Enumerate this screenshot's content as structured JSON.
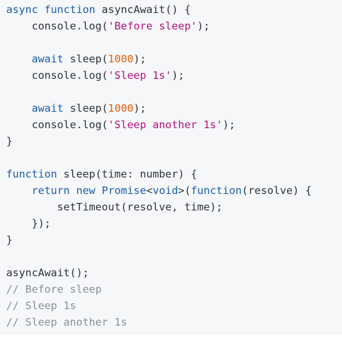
{
  "colors": {
    "background": "#f6f7f9",
    "plain": "#2f3337",
    "keyword": "#1b5ea8",
    "string": "#b3127d",
    "number": "#ea5d0b",
    "comment": "#8b9096"
  },
  "code": {
    "lines": [
      [
        {
          "type": "keyword",
          "text": "async"
        },
        {
          "type": "plain",
          "text": " "
        },
        {
          "type": "keyword",
          "text": "function"
        },
        {
          "type": "plain",
          "text": " asyncAwait() {"
        }
      ],
      [
        {
          "type": "plain",
          "text": "    console.log("
        },
        {
          "type": "string",
          "text": "'Before sleep'"
        },
        {
          "type": "plain",
          "text": ");"
        }
      ],
      [],
      [
        {
          "type": "plain",
          "text": "    "
        },
        {
          "type": "keyword",
          "text": "await"
        },
        {
          "type": "plain",
          "text": " sleep("
        },
        {
          "type": "number",
          "text": "1000"
        },
        {
          "type": "plain",
          "text": ");"
        }
      ],
      [
        {
          "type": "plain",
          "text": "    console.log("
        },
        {
          "type": "string",
          "text": "'Sleep 1s'"
        },
        {
          "type": "plain",
          "text": ");"
        }
      ],
      [],
      [
        {
          "type": "plain",
          "text": "    "
        },
        {
          "type": "keyword",
          "text": "await"
        },
        {
          "type": "plain",
          "text": " sleep("
        },
        {
          "type": "number",
          "text": "1000"
        },
        {
          "type": "plain",
          "text": ");"
        }
      ],
      [
        {
          "type": "plain",
          "text": "    console.log("
        },
        {
          "type": "string",
          "text": "'Sleep another 1s'"
        },
        {
          "type": "plain",
          "text": ");"
        }
      ],
      [
        {
          "type": "plain",
          "text": "}"
        }
      ],
      [],
      [
        {
          "type": "keyword",
          "text": "function"
        },
        {
          "type": "plain",
          "text": " sleep(time: number) {"
        }
      ],
      [
        {
          "type": "plain",
          "text": "    "
        },
        {
          "type": "keyword",
          "text": "return"
        },
        {
          "type": "plain",
          "text": " "
        },
        {
          "type": "keyword",
          "text": "new"
        },
        {
          "type": "plain",
          "text": " "
        },
        {
          "type": "keyword",
          "text": "Promise"
        },
        {
          "type": "plain",
          "text": "<"
        },
        {
          "type": "keyword",
          "text": "void"
        },
        {
          "type": "plain",
          "text": ">("
        },
        {
          "type": "keyword",
          "text": "function"
        },
        {
          "type": "plain",
          "text": "(resolve) {"
        }
      ],
      [
        {
          "type": "plain",
          "text": "        setTimeout(resolve, time);"
        }
      ],
      [
        {
          "type": "plain",
          "text": "    });"
        }
      ],
      [
        {
          "type": "plain",
          "text": "}"
        }
      ],
      [],
      [
        {
          "type": "plain",
          "text": "asyncAwait();"
        }
      ],
      [
        {
          "type": "comment",
          "text": "// Before sleep"
        }
      ],
      [
        {
          "type": "comment",
          "text": "// Sleep 1s"
        }
      ],
      [
        {
          "type": "comment",
          "text": "// Sleep another 1s"
        }
      ]
    ]
  }
}
